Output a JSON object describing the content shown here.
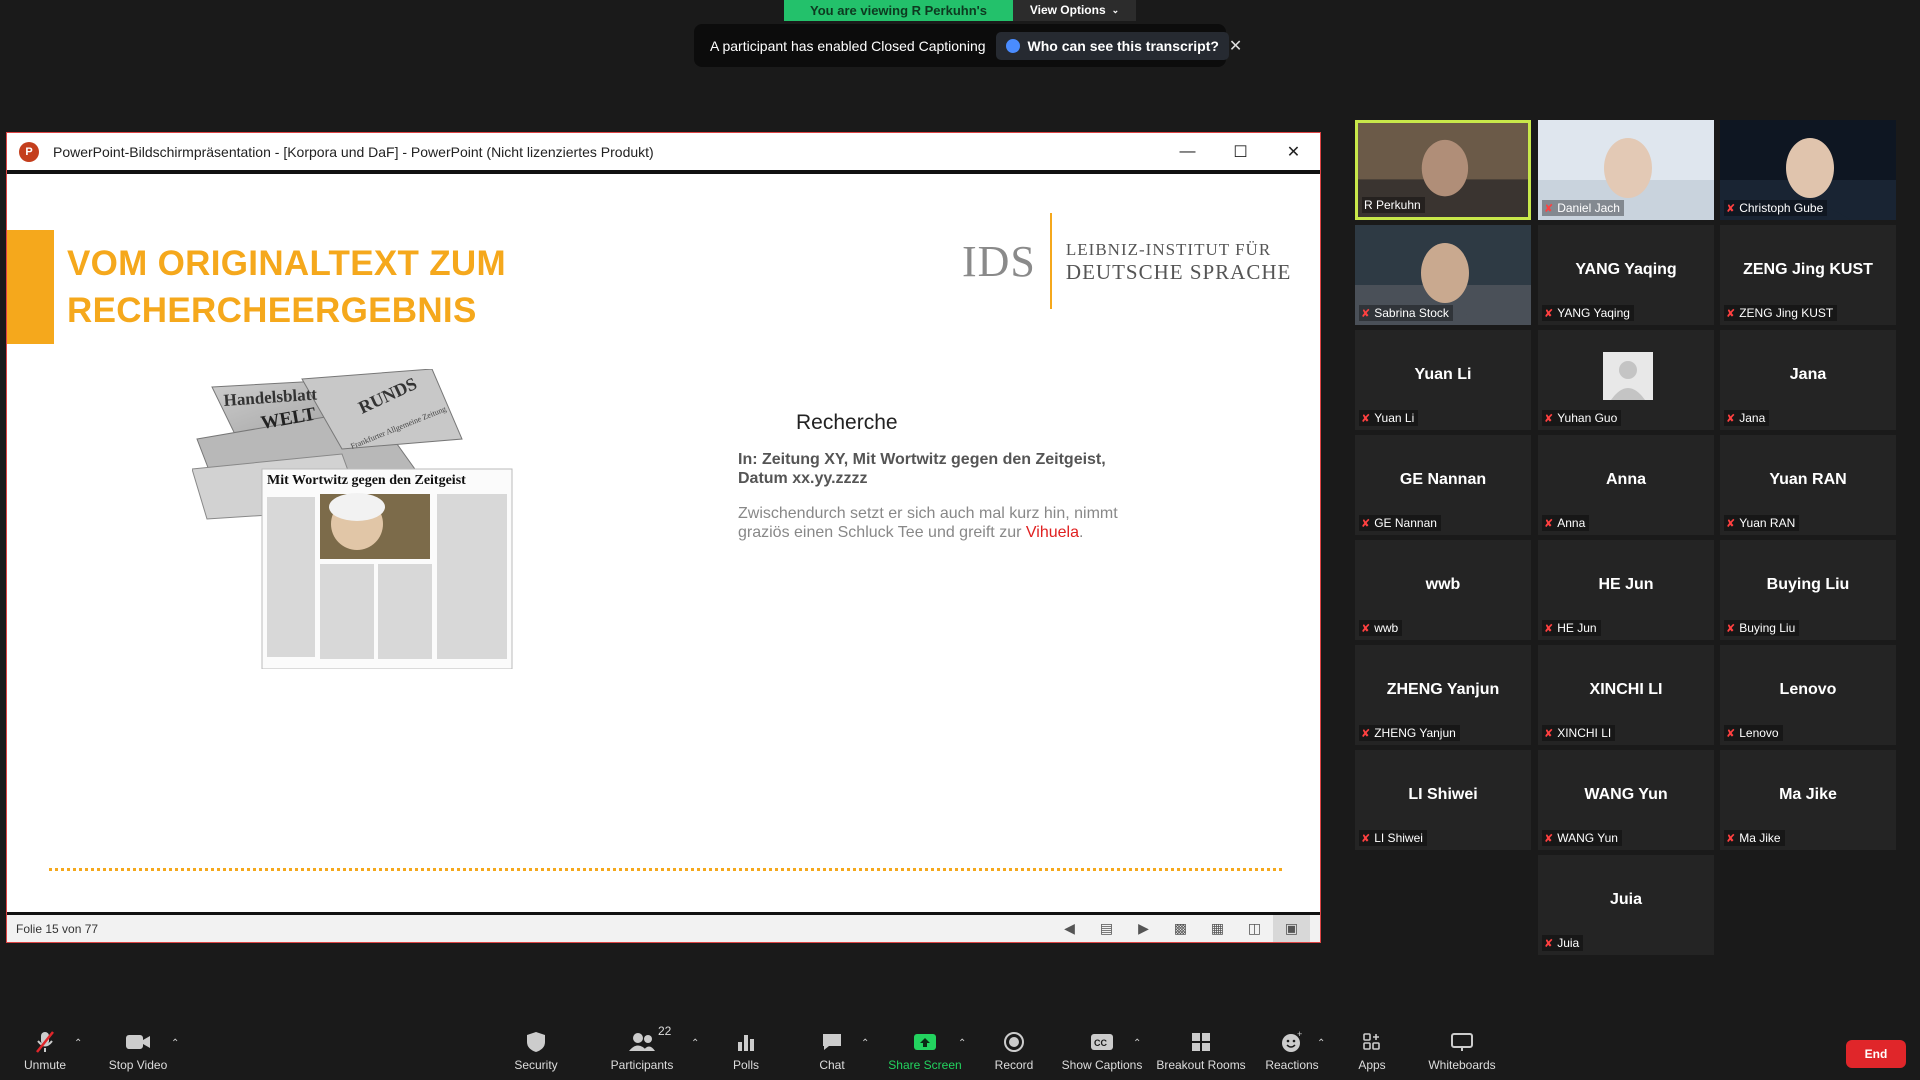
{
  "share_banner": {
    "viewing_text": "You are viewing R Perkuhn's screen",
    "view_options": "View Options"
  },
  "cc_banner": {
    "text": "A participant has enabled Closed Captioning",
    "who_button": "Who can see this transcript?"
  },
  "ppt_window": {
    "title": "PowerPoint-Bildschirmpräsentation - [Korpora und DaF] - PowerPoint (Nicht lizenziertes Produkt)",
    "status": "Folie 15 von 77"
  },
  "slide": {
    "title_line1": "VOM ORIGINALTEXT ZUM",
    "title_line2": "RECHERCHEERGEBNIS",
    "logo_abbr": "IDS",
    "logo_line1": "LEIBNIZ-INSTITUT FÜR",
    "logo_line2": "DEUTSCHE SPRACHE",
    "newspaper_mastheads": [
      "Handelsblatt",
      "WELT",
      "RUNDS",
      "Frankfurter Allgemeine Zeitung"
    ],
    "newspaper_headline": "Mit Wortwitz gegen den Zeitgeist",
    "recherche_title": "Recherche",
    "recherche_source": "In: Zeitung XY, Mit Wortwitz gegen den Zeitgeist, Datum xx.yy.zzzz",
    "recherche_body": "Zwischendurch setzt er sich auch mal kurz hin, nimmt graziös einen Schluck Tee und greift zur",
    "recherche_highlight": "Vihuela",
    "recherche_period": "."
  },
  "participants": [
    {
      "label": "R Perkuhn",
      "center": "",
      "video": true,
      "active": true,
      "muted": false
    },
    {
      "label": "Daniel Jach",
      "center": "",
      "video": true,
      "active": false,
      "muted": true
    },
    {
      "label": "Christoph Gube",
      "center": "",
      "video": true,
      "active": false,
      "muted": true
    },
    {
      "label": "Sabrina Stock",
      "center": "",
      "video": true,
      "active": false,
      "muted": true
    },
    {
      "label": "YANG Yaqing",
      "center": "YANG Yaqing",
      "video": false,
      "muted": true
    },
    {
      "label": "ZENG Jing KUST",
      "center": "ZENG Jing KUST",
      "video": false,
      "muted": true
    },
    {
      "label": "Yuan Li",
      "center": "Yuan Li",
      "video": false,
      "muted": true
    },
    {
      "label": "Yuhan Guo",
      "center": "",
      "video": false,
      "avatar": true,
      "muted": true
    },
    {
      "label": "Jana",
      "center": "Jana",
      "video": false,
      "muted": true
    },
    {
      "label": "GE Nannan",
      "center": "GE Nannan",
      "video": false,
      "muted": true
    },
    {
      "label": "Anna",
      "center": "Anna",
      "video": false,
      "muted": true
    },
    {
      "label": "Yuan RAN",
      "center": "Yuan RAN",
      "video": false,
      "muted": true
    },
    {
      "label": "wwb",
      "center": "wwb",
      "video": false,
      "muted": true
    },
    {
      "label": "HE Jun",
      "center": "HE Jun",
      "video": false,
      "muted": true
    },
    {
      "label": "Buying Liu",
      "center": "Buying Liu",
      "video": false,
      "muted": true
    },
    {
      "label": "ZHENG Yanjun",
      "center": "ZHENG Yanjun",
      "video": false,
      "muted": true
    },
    {
      "label": "XINCHI LI",
      "center": "XINCHI LI",
      "video": false,
      "muted": true
    },
    {
      "label": "Lenovo",
      "center": "Lenovo",
      "video": false,
      "muted": true
    },
    {
      "label": "LI Shiwei",
      "center": "LI Shiwei",
      "video": false,
      "muted": true
    },
    {
      "label": "WANG Yun",
      "center": "WANG Yun",
      "video": false,
      "muted": true
    },
    {
      "label": "Ma Jike",
      "center": "Ma Jike",
      "video": false,
      "muted": true
    },
    {
      "label": "Juia",
      "center": "Juia",
      "video": false,
      "muted": true
    }
  ],
  "toolbar": {
    "unmute": "Unmute",
    "stop_video": "Stop Video",
    "security": "Security",
    "participants": "Participants",
    "participants_count": "22",
    "polls": "Polls",
    "chat": "Chat",
    "share_screen": "Share Screen",
    "record": "Record",
    "show_captions": "Show Captions",
    "breakout_rooms": "Breakout Rooms",
    "reactions": "Reactions",
    "apps": "Apps",
    "whiteboards": "Whiteboards",
    "end": "End"
  },
  "colors": {
    "accent_orange": "#f5a81c",
    "share_green": "#23c16b",
    "end_red": "#e0262a",
    "active_speaker": "#c8e84a"
  }
}
